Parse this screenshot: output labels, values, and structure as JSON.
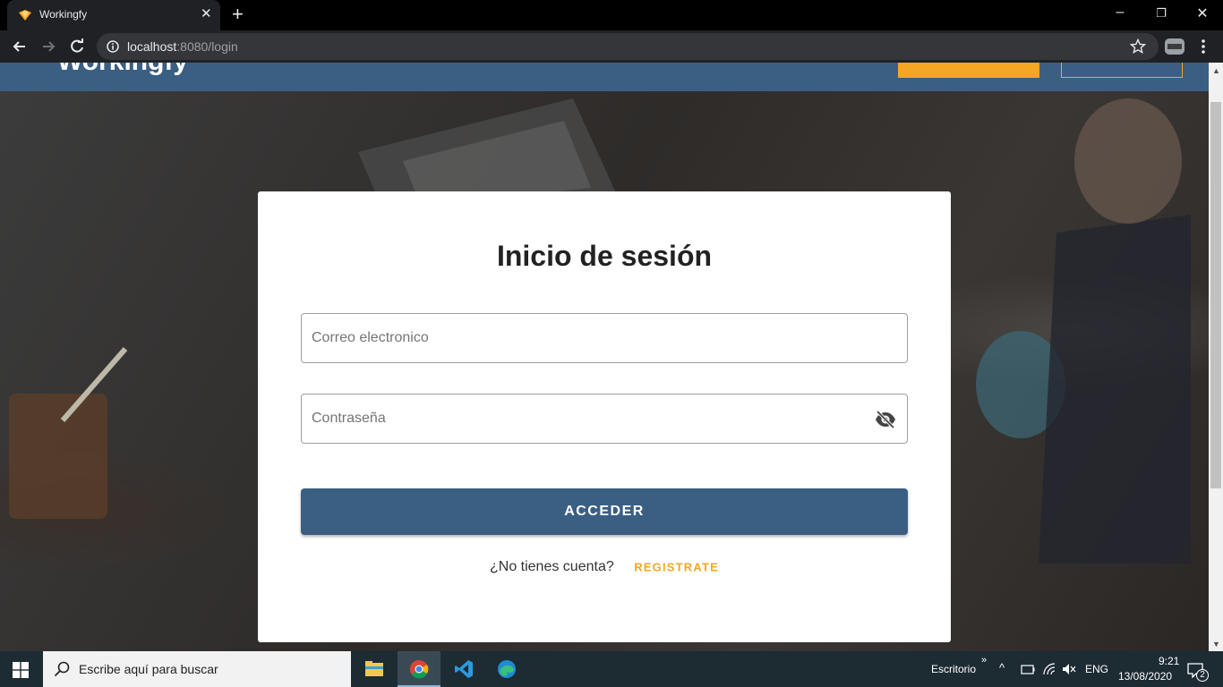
{
  "browser": {
    "tab_title": "Workingfy",
    "url_host": "localhost",
    "url_rest": ":8080/login"
  },
  "site": {
    "brand": "Workingfy"
  },
  "login": {
    "title": "Inicio de sesión",
    "email_placeholder": "Correo electronico",
    "password_placeholder": "Contraseña",
    "submit_label": "ACCEDER",
    "no_account_text": "¿No tienes cuenta?",
    "register_label": "REGISTRATE"
  },
  "taskbar": {
    "search_placeholder": "Escribe aquí para buscar",
    "desktop_label": "Escritorio",
    "language": "ENG",
    "time": "9:21",
    "date": "13/08/2020",
    "notifications_count": "2"
  },
  "colors": {
    "primary": "#3b5f83",
    "accent": "#f5a623"
  },
  "icons": [
    "workingfy-favicon",
    "close-icon",
    "plus-icon",
    "minimize-icon",
    "restore-icon",
    "back-icon",
    "forward-icon",
    "reload-icon",
    "info-icon",
    "star-icon",
    "profile-icon",
    "menu-icon",
    "visibility-off-icon",
    "windows-icon",
    "search-icon",
    "file-explorer-icon",
    "chrome-icon",
    "vscode-icon",
    "edge-icon"
  ]
}
